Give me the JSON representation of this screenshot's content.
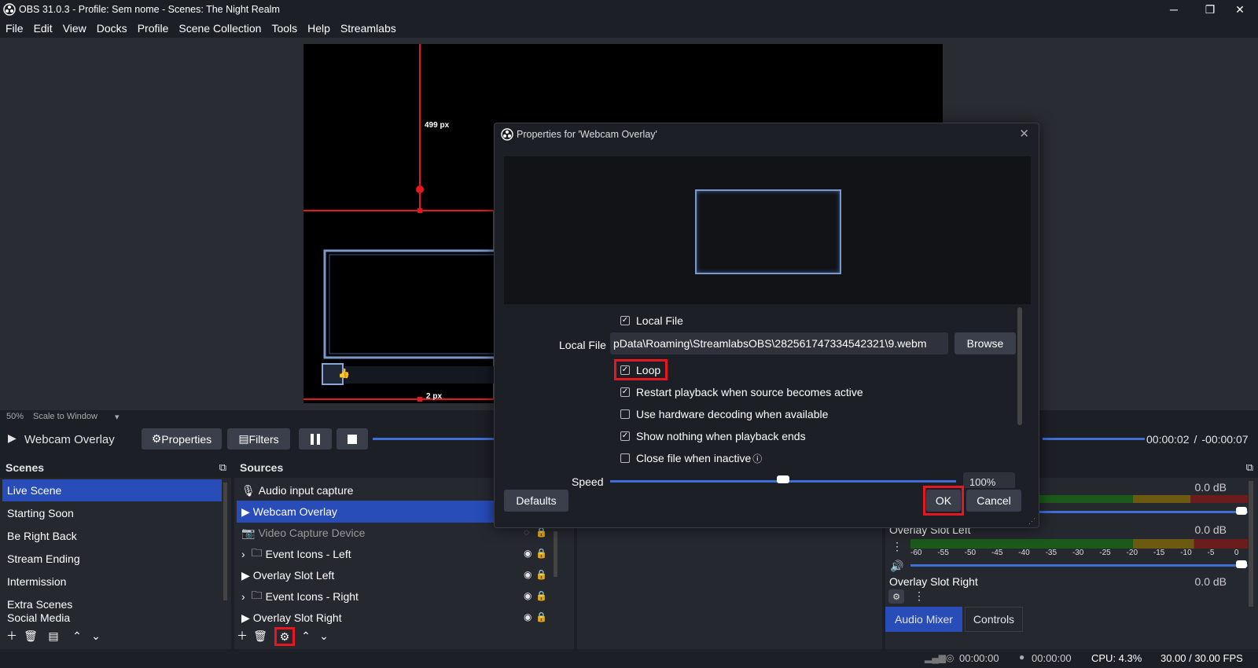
{
  "window": {
    "title": "OBS 31.0.3 - Profile: Sem nome - Scenes: The Night Realm",
    "minimize": "─",
    "maximize": "❐",
    "close": "✕"
  },
  "menu": [
    "File",
    "Edit",
    "View",
    "Docks",
    "Profile",
    "Scene Collection",
    "Tools",
    "Help",
    "Streamlabs"
  ],
  "preview": {
    "measure_top": "499 px",
    "measure_bottom": "2 px",
    "zoom": "50%",
    "scale_mode": "Scale to Window"
  },
  "controls": {
    "source_name": "Webcam Overlay",
    "properties": "Properties",
    "filters": "Filters",
    "time_current": "00:00:02",
    "time_sep": "/",
    "time_remaining": "-00:00:07"
  },
  "scenes": {
    "header": "Scenes",
    "items": [
      "Live Scene",
      "Starting Soon",
      "Be Right Back",
      "Stream Ending",
      "Intermission",
      "Extra Scenes",
      "Social Media"
    ]
  },
  "sources": {
    "header": "Sources",
    "items": [
      {
        "label": "Audio input capture",
        "icon": "mic-icon"
      },
      {
        "label": "Webcam Overlay",
        "icon": "play-icon"
      },
      {
        "label": "Video Capture Device",
        "icon": "camera-icon"
      },
      {
        "label": "Event Icons - Left",
        "icon": "folder-icon"
      },
      {
        "label": "Overlay Slot Left",
        "icon": "play-icon"
      },
      {
        "label": "Event Icons - Right",
        "icon": "folder-icon"
      },
      {
        "label": "Overlay Slot Right",
        "icon": "play-icon"
      }
    ]
  },
  "mixer": {
    "tracks": [
      {
        "name": "",
        "db": "0.0 dB"
      },
      {
        "name": "Overlay Slot Left",
        "db": "0.0 dB"
      },
      {
        "name": "Overlay Slot Right",
        "db": "0.0 dB"
      }
    ],
    "scale": [
      "-60",
      "-55",
      "-50",
      "-45",
      "-40",
      "-35",
      "-30",
      "-25",
      "-20",
      "-15",
      "-10",
      "-5",
      "0"
    ],
    "tab_audio": "Audio Mixer",
    "tab_controls": "Controls"
  },
  "dialog": {
    "title": "Properties for 'Webcam Overlay'",
    "local_file_checkbox": "Local File",
    "local_file_label": "Local File",
    "local_file_path": "pData\\Roaming\\StreamlabsOBS\\282561747334542321\\9.webm",
    "browse": "Browse",
    "options": [
      {
        "label": "Loop",
        "checked": true
      },
      {
        "label": "Restart playback when source becomes active",
        "checked": true
      },
      {
        "label": "Use hardware decoding when available",
        "checked": false
      },
      {
        "label": "Show nothing when playback ends",
        "checked": true
      },
      {
        "label": "Close file when inactive",
        "checked": false
      }
    ],
    "speed_label": "Speed",
    "speed_value": "100%",
    "speed_fraction": 0.5,
    "defaults": "Defaults",
    "ok": "OK",
    "cancel": "Cancel"
  },
  "status": {
    "rec_time": "00:00:00",
    "stream_time": "00:00:00",
    "cpu": "CPU: 4.3%",
    "fps": "30.00 / 30.00 FPS"
  }
}
